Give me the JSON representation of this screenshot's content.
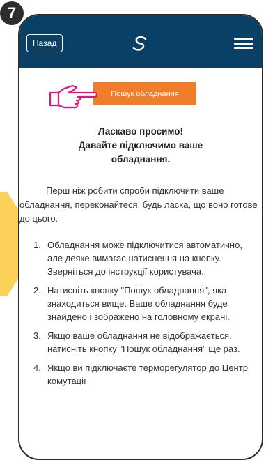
{
  "step_number": "7",
  "header": {
    "back_label": "Назад",
    "logo_icon": "logo-icon",
    "menu_icon": "hamburger-menu-icon"
  },
  "search_button_label": "Пошук обладнання",
  "pointer_icon": "pointing-hand-icon",
  "welcome": {
    "line1": "Ласкаво просимо!",
    "line2": "Давайте підключимо ваше",
    "line3": "обладнання."
  },
  "intro_text": "Перш ніж робити спроби підключити ваше обладнання, переконайтеся, будь ласка, що воно готове до цього.",
  "steps": [
    {
      "num": "1.",
      "text": "Обладнання може підключитися автоматично, але деяке вимагає натиснення на кнопку. Зверніться до інструкції користувача."
    },
    {
      "num": "2.",
      "text": "Натисніть кнопку \"Пошук обладнання\", яка знаходиться вище. Ваше обладнання буде знайдено і зображено на головному екрані."
    },
    {
      "num": "3.",
      "text": "Якщо ваше обладнання не відображається, натисніть кнопку \"Пошук обладнання\" ще раз."
    },
    {
      "num": "4.",
      "text": "Якщо ви підключаєте терморегулятор до Центр комутації"
    }
  ],
  "colors": {
    "header_bg": "#0a3f66",
    "accent_orange": "#ef7d29",
    "hand_pink": "#e0147a",
    "arrow_yellow": "#fbd15a"
  }
}
